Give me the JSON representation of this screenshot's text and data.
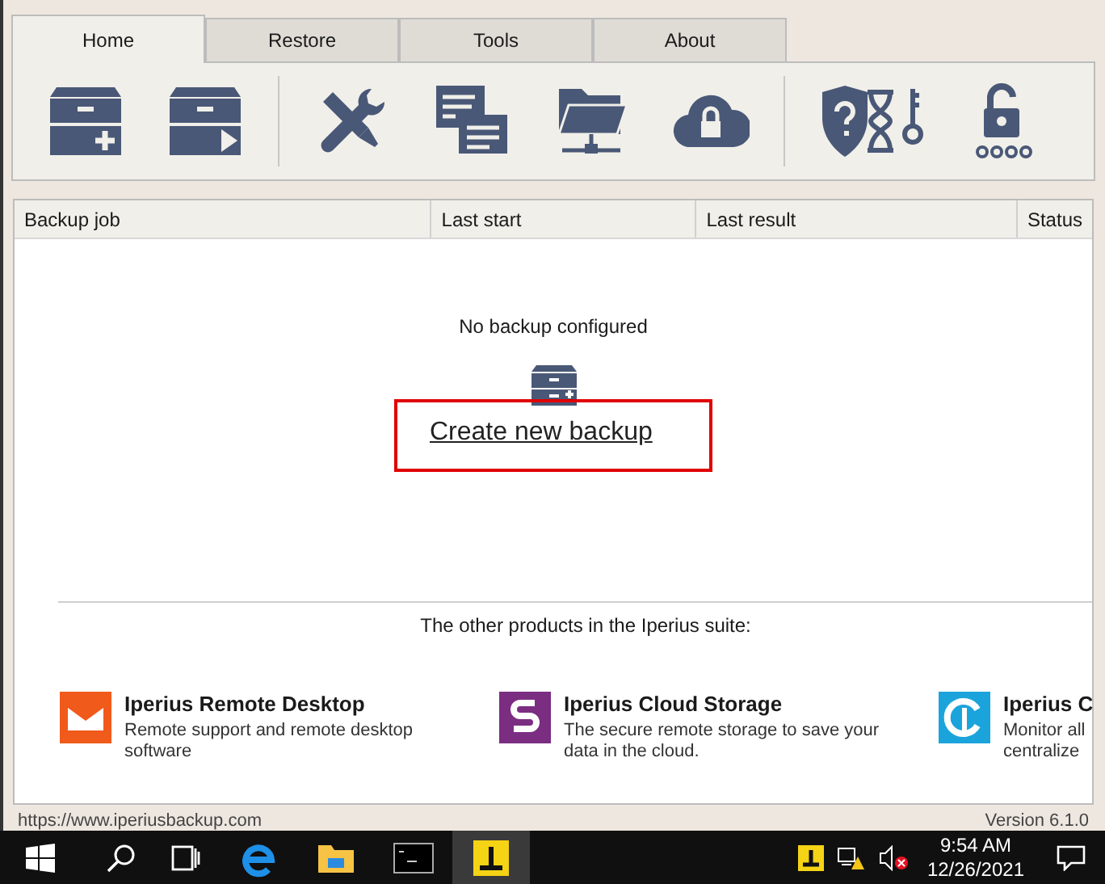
{
  "tabs": [
    {
      "label": "Home",
      "selected": true
    },
    {
      "label": "Restore",
      "selected": false
    },
    {
      "label": "Tools",
      "selected": false
    },
    {
      "label": "About",
      "selected": false
    }
  ],
  "table": {
    "columns": [
      "Backup job",
      "Last start",
      "Last result",
      "Status"
    ]
  },
  "empty_state": {
    "message": "No backup configured",
    "link": "Create new backup"
  },
  "products": {
    "heading": "The other products in the Iperius suite:",
    "items": [
      {
        "kind": "remote",
        "color": "#f05a1a",
        "name": "Iperius Remote Desktop",
        "description_lines": [
          "Remote support and remote desktop",
          "software"
        ]
      },
      {
        "kind": "storage",
        "color": "#7b2d82",
        "name": "Iperius Cloud Storage",
        "description_lines": [
          "The secure remote storage to save your",
          "data in the cloud."
        ]
      },
      {
        "kind": "console",
        "color": "#1ba4dc",
        "name": "Iperius C",
        "description_lines": [
          "Monitor all",
          "centralize"
        ]
      }
    ]
  },
  "status_bar": {
    "url": "https://www.iperiusbackup.com",
    "version": "Version 6.1.0"
  },
  "taskbar": {
    "time": "9:54 AM",
    "date": "12/26/2021",
    "apps": [
      {
        "kind": "edge",
        "selected": false
      },
      {
        "kind": "explorer",
        "selected": false
      },
      {
        "kind": "cmd",
        "selected": false
      },
      {
        "kind": "iperius",
        "selected": true
      }
    ]
  }
}
